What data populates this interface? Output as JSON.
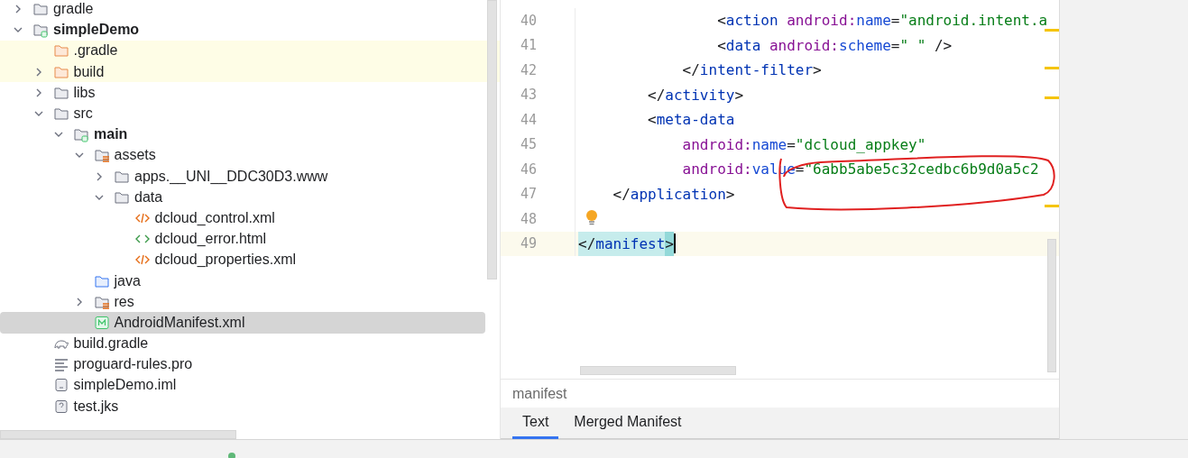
{
  "project_tree": [
    {
      "label": "gradle",
      "kind": "folder",
      "expanded": false,
      "selected": false
    },
    {
      "label": "simpleDemo",
      "kind": "module",
      "expanded": true,
      "selected": false,
      "children": [
        {
          "label": ".gradle",
          "kind": "excluded-folder",
          "selected": false
        },
        {
          "label": "build",
          "kind": "excluded-folder",
          "expanded": false,
          "selected": false
        },
        {
          "label": "libs",
          "kind": "folder",
          "expanded": false,
          "selected": false
        },
        {
          "label": "src",
          "kind": "folder",
          "expanded": true,
          "selected": false,
          "children": [
            {
              "label": "main",
              "kind": "module",
              "expanded": true,
              "selected": false,
              "children": [
                {
                  "label": "assets",
                  "kind": "resource-folder",
                  "expanded": true,
                  "selected": false,
                  "children": [
                    {
                      "label": "apps.__UNI__DDC30D3.www",
                      "kind": "folder",
                      "expanded": false,
                      "selected": false
                    },
                    {
                      "label": "data",
                      "kind": "folder",
                      "expanded": true,
                      "selected": false,
                      "children": [
                        {
                          "label": "dcloud_control.xml",
                          "kind": "xml",
                          "selected": false
                        },
                        {
                          "label": "dcloud_error.html",
                          "kind": "html",
                          "selected": false
                        },
                        {
                          "label": "dcloud_properties.xml",
                          "kind": "xml",
                          "selected": false
                        }
                      ]
                    }
                  ]
                },
                {
                  "label": "java",
                  "kind": "source-folder",
                  "selected": false
                },
                {
                  "label": "res",
                  "kind": "resource-folder",
                  "expanded": false,
                  "selected": false
                },
                {
                  "label": "AndroidManifest.xml",
                  "kind": "manifest",
                  "selected": true
                }
              ]
            }
          ]
        },
        {
          "label": "build.gradle",
          "kind": "gradle",
          "selected": false
        },
        {
          "label": "proguard-rules.pro",
          "kind": "text",
          "selected": false
        },
        {
          "label": "simpleDemo.iml",
          "kind": "iml",
          "selected": false
        },
        {
          "label": "test.jks",
          "kind": "unknown",
          "selected": false
        }
      ]
    }
  ],
  "editor": {
    "lines": [
      {
        "number": "40",
        "current": false,
        "bulb": false,
        "caret": false,
        "text": "                <action android:name=\"android.intent.a"
      },
      {
        "number": "41",
        "current": false,
        "bulb": false,
        "caret": false,
        "text": "                <data android:scheme=\" \" />"
      },
      {
        "number": "42",
        "current": false,
        "bulb": false,
        "caret": false,
        "text": "            </intent-filter>"
      },
      {
        "number": "43",
        "current": false,
        "bulb": false,
        "caret": false,
        "text": "        </activity>"
      },
      {
        "number": "44",
        "current": false,
        "bulb": false,
        "caret": false,
        "text": "        <meta-data"
      },
      {
        "number": "45",
        "current": false,
        "bulb": false,
        "caret": false,
        "text": "            android:name=\"dcloud_appkey\""
      },
      {
        "number": "46",
        "current": false,
        "bulb": false,
        "caret": false,
        "text": "            android:value=\"6abb5abe5c32cedbc6b9d0a5c2"
      },
      {
        "number": "47",
        "current": false,
        "bulb": false,
        "caret": false,
        "text": "    </application>"
      },
      {
        "number": "48",
        "current": false,
        "bulb": true,
        "caret": false
      },
      {
        "number": "49",
        "current": true,
        "bulb": false,
        "caret": true,
        "text": "</manifest>",
        "matched": true
      }
    ],
    "breadcrumb": "manifest",
    "tabs": [
      {
        "label": "Text",
        "selected": true
      },
      {
        "label": "Merged Manifest",
        "selected": false
      }
    ]
  }
}
